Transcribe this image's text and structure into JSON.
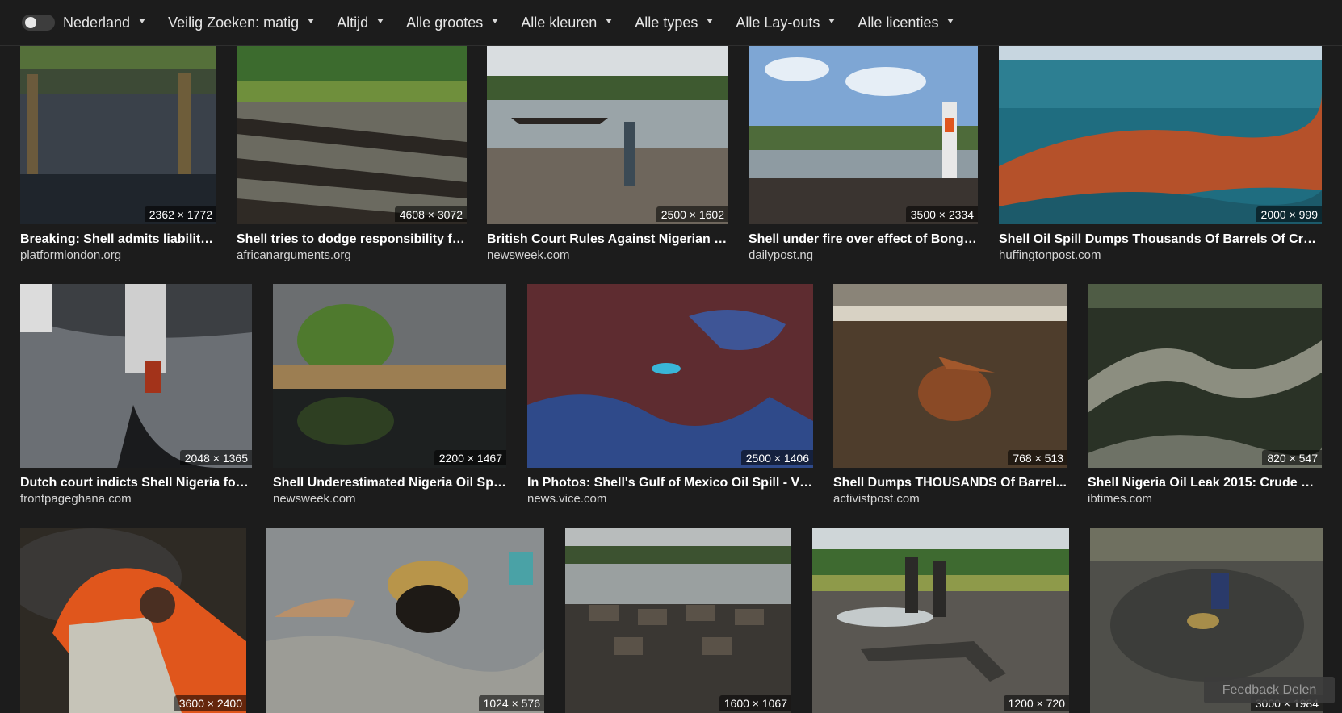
{
  "filters": {
    "safesearch_toggle_on": false,
    "region": "Nederland",
    "safe_search": "Veilig Zoeken: matig",
    "time": "Altijd",
    "size": "Alle grootes",
    "color": "Alle kleuren",
    "type": "Alle types",
    "layout": "Alle Lay-outs",
    "license": "Alle licenties"
  },
  "results": [
    {
      "title": "Breaking: Shell admits liability ...",
      "source": "platformlondon.org",
      "dims": "2362 × 1772"
    },
    {
      "title": "Shell tries to dodge responsibility fo...",
      "source": "africanarguments.org",
      "dims": "4608 × 3072"
    },
    {
      "title": "British Court Rules Against Nigerian V...",
      "source": "newsweek.com",
      "dims": "2500 × 1602"
    },
    {
      "title": "Shell under fire over effect of Bonga...",
      "source": "dailypost.ng",
      "dims": "3500 × 2334"
    },
    {
      "title": "Shell Oil Spill Dumps Thousands Of Barrels Of Crud...",
      "source": "huffingtonpost.com",
      "dims": "2000 × 999"
    },
    {
      "title": "Dutch court indicts Shell Nigeria for ...",
      "source": "frontpageghana.com",
      "dims": "2048 × 1365"
    },
    {
      "title": "Shell Underestimated Nigeria Oil Spil...",
      "source": "newsweek.com",
      "dims": "2200 × 1467"
    },
    {
      "title": "In Photos: Shell's Gulf of Mexico Oil Spill - VIC...",
      "source": "news.vice.com",
      "dims": "2500 × 1406"
    },
    {
      "title": "Shell Dumps THOUSANDS Of Barrel...",
      "source": "activistpost.com",
      "dims": "768 × 513"
    },
    {
      "title": "Shell Nigeria Oil Leak 2015: Crude Ex...",
      "source": "ibtimes.com",
      "dims": "820 × 547"
    },
    {
      "title": "",
      "source": "",
      "dims": "3600 × 2400"
    },
    {
      "title": "",
      "source": "",
      "dims": "1024 × 576"
    },
    {
      "title": "",
      "source": "",
      "dims": "1600 × 1067"
    },
    {
      "title": "",
      "source": "",
      "dims": "1200 × 720"
    },
    {
      "title": "",
      "source": "",
      "dims": "3000 × 1984"
    }
  ],
  "feedback_label": "Feedback Delen"
}
